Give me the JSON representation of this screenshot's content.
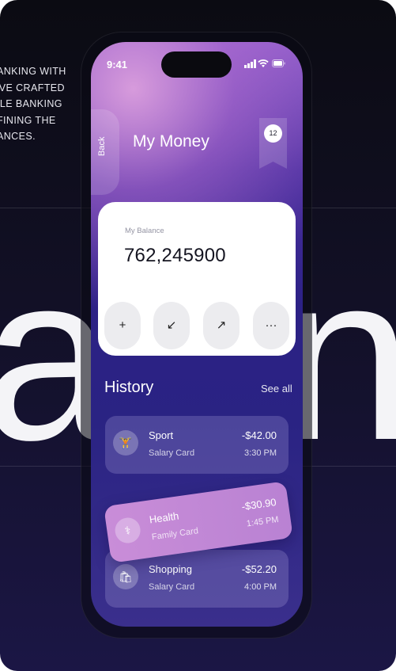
{
  "background": {
    "big_text": "a in",
    "side_copy": [
      "ANKING WITH",
      "'VE CRAFTED",
      "ILE BANKING",
      "FINING THE",
      "ANCES."
    ]
  },
  "status_bar": {
    "time": "9:41"
  },
  "header": {
    "back_label": "Back",
    "title": "My Money",
    "badge": "12"
  },
  "balance_card": {
    "label": "My Balance",
    "amount": "762,245900",
    "actions": [
      {
        "icon": "plus-icon",
        "glyph": "+"
      },
      {
        "icon": "arrow-down-left-icon",
        "glyph": "↙"
      },
      {
        "icon": "arrow-up-right-icon",
        "glyph": "↗"
      },
      {
        "icon": "more-icon",
        "glyph": "···"
      }
    ]
  },
  "history": {
    "title": "History",
    "see_all": "See all",
    "items": [
      {
        "name": "Sport",
        "card": "Salary Card",
        "amount": "-$42.00",
        "time": "3:30 PM",
        "icon": "dumbbell-icon",
        "glyph": "🏋"
      },
      {
        "name": "Health",
        "card": "Family Card",
        "amount": "-$30.90",
        "time": "1:45 PM",
        "icon": "health-icon",
        "glyph": "⚕"
      },
      {
        "name": "Shopping",
        "card": "Salary Card",
        "amount": "-$52.20",
        "time": "4:00 PM",
        "icon": "shopping-bag-icon",
        "glyph": "🛍"
      }
    ]
  },
  "colors": {
    "accent": "#c98dd8",
    "phone_bg": "#2c2185",
    "card": "#ffffff"
  }
}
